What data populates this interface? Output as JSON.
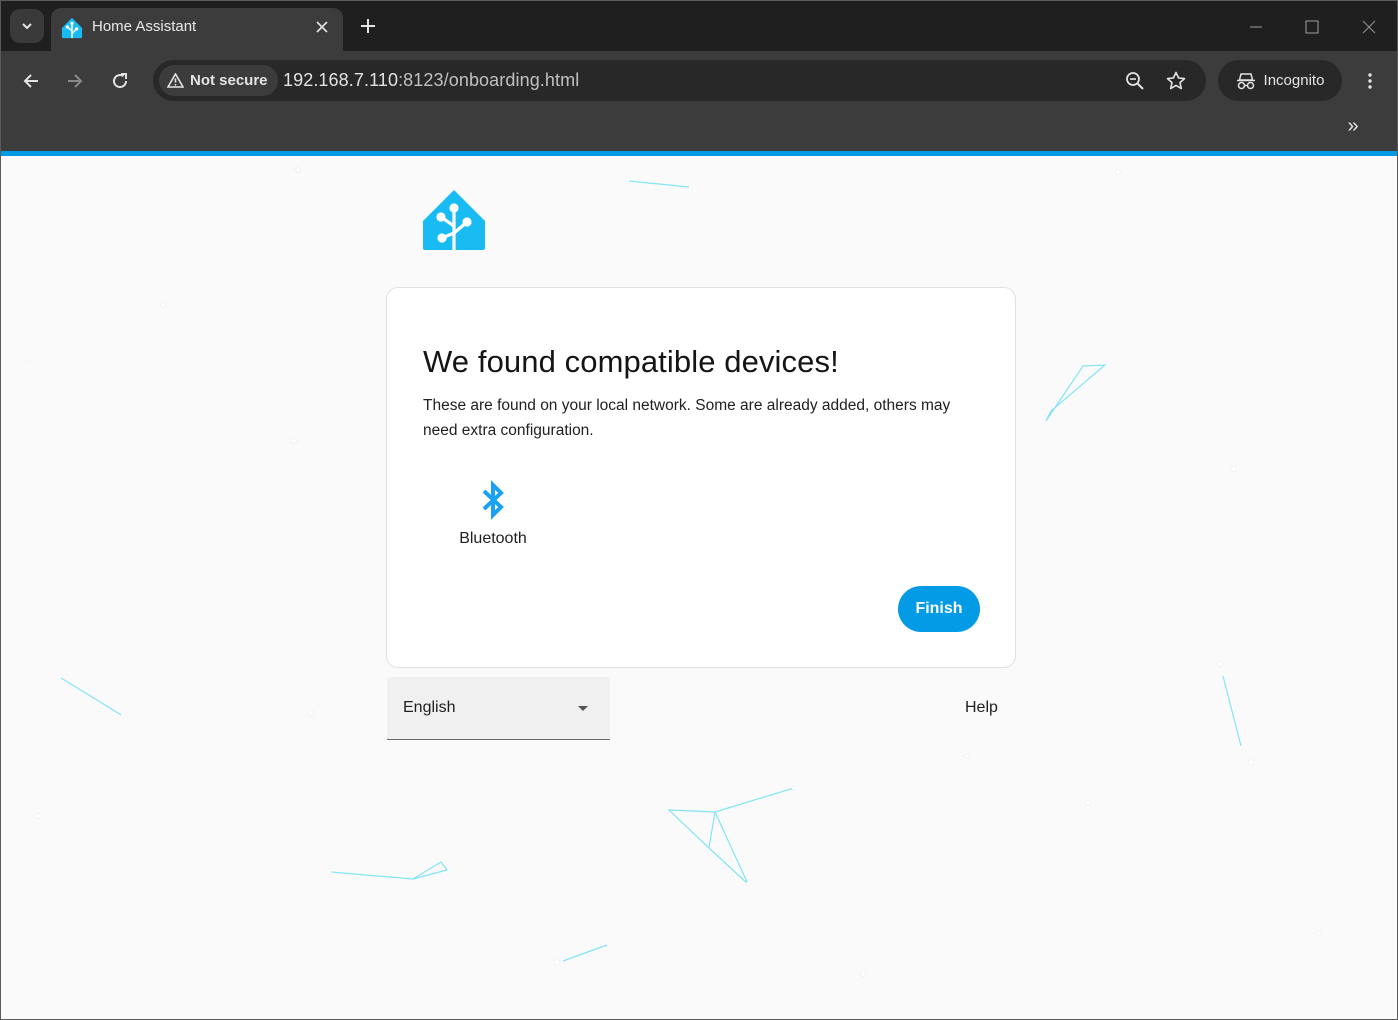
{
  "browser": {
    "tab": {
      "title": "Home Assistant"
    },
    "security_label": "Not secure",
    "url_host": "192.168.7.110",
    "url_path": ":8123/onboarding.html",
    "incognito_label": "Incognito"
  },
  "card": {
    "title": "We found compatible devices!",
    "description": "These are found on your local network. Some are already added, others may need extra configuration.",
    "integrations": [
      {
        "name": "Bluetooth",
        "icon": "bluetooth-icon"
      }
    ],
    "finish_label": "Finish"
  },
  "footer": {
    "language": "English",
    "help_label": "Help"
  },
  "colors": {
    "accent": "#039be5",
    "logo": "#18bcf2",
    "bluetooth": "#1ba1f2"
  }
}
